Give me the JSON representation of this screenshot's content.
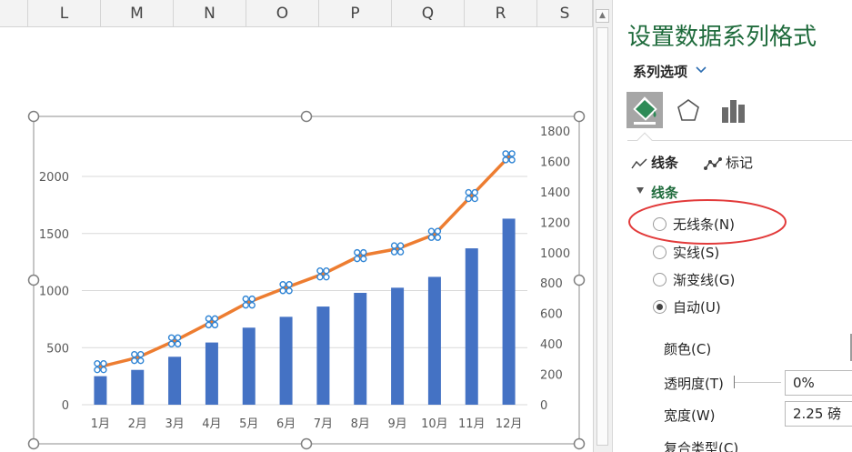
{
  "columns": [
    "L",
    "M",
    "N",
    "O",
    "P",
    "Q",
    "R",
    "S"
  ],
  "chart_data": {
    "type": "bar",
    "categories": [
      "1月",
      "2月",
      "3月",
      "4月",
      "5月",
      "6月",
      "7月",
      "8月",
      "9月",
      "10月",
      "11月",
      "12月"
    ],
    "series": [
      {
        "type": "bar",
        "axis": "primary",
        "color": "#4472c4",
        "values": [
          250,
          305,
          420,
          545,
          675,
          770,
          860,
          980,
          1025,
          1120,
          1370,
          1630
        ]
      },
      {
        "type": "line",
        "axis": "secondary",
        "color": "#ed7d31",
        "values": [
          250,
          310,
          420,
          545,
          675,
          770,
          860,
          980,
          1025,
          1120,
          1375,
          1630
        ]
      }
    ],
    "y_primary": {
      "ylim": [
        0,
        2400
      ],
      "ticks": [
        "0",
        "500",
        "1000",
        "1500",
        "2000"
      ]
    },
    "y_secondary": {
      "ylim": [
        0,
        1800
      ],
      "ticks": [
        "0",
        "200",
        "400",
        "600",
        "800",
        "1000",
        "1200",
        "1400",
        "1600",
        "1800"
      ]
    },
    "grid": true,
    "line_series_selected": true
  },
  "pane": {
    "title": "设置数据系列格式",
    "series_options": "系列选项",
    "accent_color": "#1f6b3c",
    "icons": [
      "fill-line-icon",
      "effects-pentagon-icon",
      "series-options-bar-icon"
    ],
    "tabs": {
      "line": "线条",
      "marker": "标记"
    },
    "section_title": "线条",
    "radios": [
      {
        "label": "无线条(N)",
        "checked": false
      },
      {
        "label": "实线(S)",
        "checked": false
      },
      {
        "label": "渐变线(G)",
        "checked": false
      },
      {
        "label": "自动(U)",
        "checked": true
      }
    ],
    "color_label": "颜色(C)",
    "transparency_label": "透明度(T)",
    "transparency_value": "0%",
    "width_label": "宽度(W)",
    "width_value": "2.25 磅",
    "compound_label": "复合类型(C)",
    "annotation_color": "#e23a3a"
  }
}
